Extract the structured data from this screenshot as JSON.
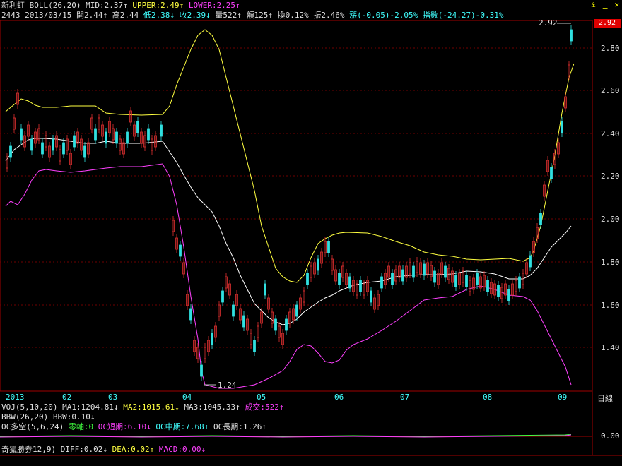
{
  "header": {
    "stock_name": "新利虹",
    "indicator": "BOLL(26,20)",
    "mid": "MID:2.37↑",
    "upper": "UPPER:2.49↑",
    "lower": "LOWER:2.25↑"
  },
  "info": {
    "code_date": "2443 2013/03/15",
    "open": "開2.44↑",
    "high": "高2.44",
    "low": "低2.38↓",
    "close": "收2.39↓",
    "volume": "量522↑",
    "amount": "額125↑",
    "turnover": "換0.12%",
    "amplitude": "振2.46%",
    "change": "漲(-0.05)-2.05%",
    "index": "指數(-24.27)-0.31%"
  },
  "window_icons": [
    "anchor-icon",
    "minimize-icon",
    "close-icon"
  ],
  "current_price": "2.92",
  "y_axis": [
    "2.80",
    "2.60",
    "2.40",
    "2.20",
    "2.00",
    "1.80",
    "1.60",
    "1.40"
  ],
  "annotations": {
    "high_label": "2.92",
    "low_label": "1.24"
  },
  "x_axis": [
    "2013",
    "02",
    "03",
    "04",
    "05",
    "06",
    "07",
    "08",
    "09"
  ],
  "period_button": "日線",
  "indicator_rows": {
    "voj": {
      "name": "VOJ(5,10,20)",
      "ma1": "MA1:1204.81↓",
      "ma2": "MA2:1015.61↓",
      "ma3": "MA3:1045.33↑",
      "vol": "成交:522↑"
    },
    "bbw": {
      "name": "BBW(26,20)",
      "value": "BBW:0.10↓"
    },
    "oc": {
      "name": "OC多空(5,6,24)",
      "zero": "零軸:0",
      "short": "OC短期:6.10↓",
      "mid": "OC中期:7.68↑",
      "long": "OC長期:1.26↑",
      "axis": "0.00"
    },
    "macd": {
      "name": "奇狐勝券12,9)",
      "diff": "DIFF:0.02↓",
      "dea": "DEA:0.02↑",
      "macd": "MACD:0.00↓"
    }
  },
  "colors": {
    "up": "#e03030",
    "down": "#30e0e0",
    "mid": "#ffffff",
    "upper": "#ffff40",
    "lower": "#ff40ff",
    "grid": "#800000",
    "tag": "#e00000"
  }
}
